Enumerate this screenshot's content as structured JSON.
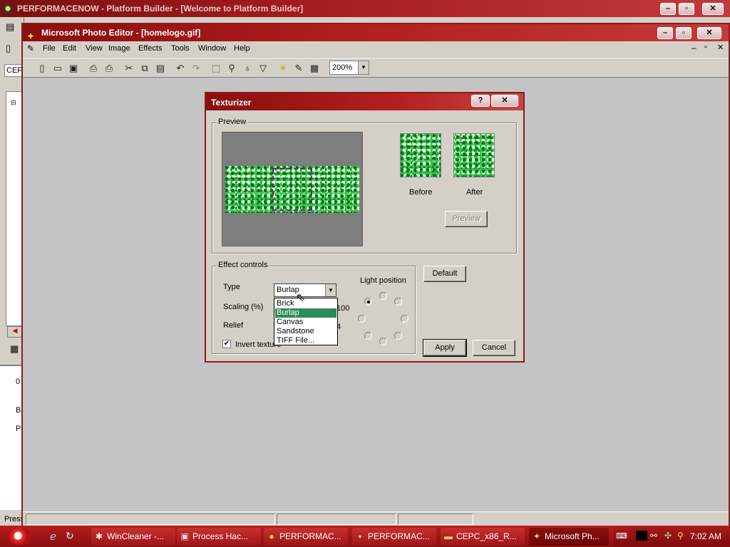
{
  "background_window": {
    "title": "PERFORMACENOW - Platform Builder - [Welcome to Platform Builder]",
    "status_text": "Press",
    "left_combo_text": "CEF",
    "output_letters": [
      "0",
      "B",
      "P"
    ]
  },
  "photo_editor": {
    "title": "Microsoft Photo Editor - [homelogo.gif]",
    "menu": [
      "File",
      "Edit",
      "View",
      "Image",
      "Effects",
      "Tools",
      "Window",
      "Help"
    ],
    "toolbar_icons": [
      "new-icon",
      "open-icon",
      "save-icon",
      "print-icon",
      "print-preview-icon",
      "cut-icon",
      "copy-icon",
      "paste-icon",
      "undo-icon",
      "redo-icon",
      "select-icon",
      "zoom-icon",
      "smudge-icon",
      "sharpen-icon",
      "balance-icon",
      "pen-icon",
      "properties-icon"
    ],
    "zoom_value": "200%"
  },
  "dialog": {
    "title": "Texturizer",
    "help_btn": "?",
    "close_btn": "✕",
    "preview_group": "Preview",
    "before_label": "Before",
    "after_label": "After",
    "preview_btn": "Preview",
    "effect_group": "Effect controls",
    "type_label": "Type",
    "type_value": "Burlap",
    "type_options": [
      "Brick",
      "Burlap",
      "Canvas",
      "Sandstone",
      "TIFF File..."
    ],
    "type_selected_index": 1,
    "scaling_label": "Scaling (%)",
    "scaling_value": "100",
    "relief_label": "Relief",
    "relief_value": "4",
    "invert_label": "Invert texture",
    "invert_checked": true,
    "light_position_label": "Light position",
    "light_selected": "top-left",
    "default_btn": "Default",
    "apply_btn": "Apply",
    "cancel_btn": "Cancel"
  },
  "taskbar": {
    "items": [
      {
        "label": "WinCleaner -...",
        "icon": "wincleaner-icon"
      },
      {
        "label": "Process Hac...",
        "icon": "process-hacker-icon"
      },
      {
        "label": "PERFORMAC...",
        "icon": "platform-builder-icon"
      },
      {
        "label": "PERFORMAC...",
        "icon": "console-icon"
      },
      {
        "label": "CEPC_x86_R...",
        "icon": "folder-icon"
      },
      {
        "label": "Microsoft Ph...",
        "icon": "photo-editor-icon"
      }
    ],
    "clock": "7:02 AM"
  },
  "colors": {
    "title_red": "#b41f1f",
    "selection_green": "#2e8b57",
    "texture_green": "#33c94a"
  }
}
